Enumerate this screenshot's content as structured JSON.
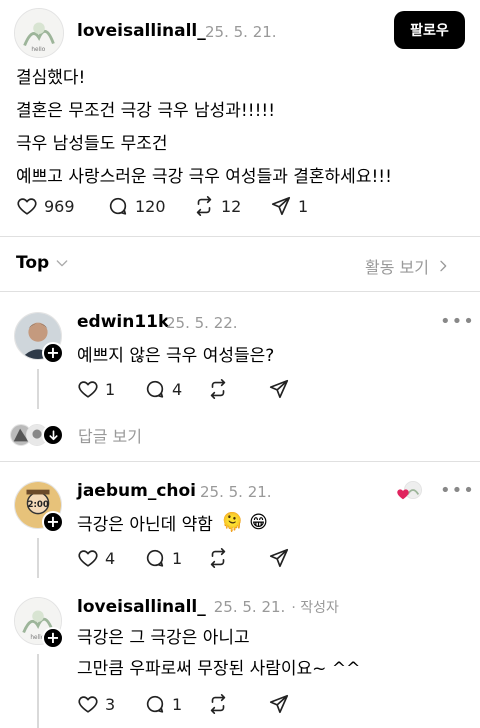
{
  "post": {
    "username": "loveisallinall_",
    "date": "25. 5. 21.",
    "follow_label": "팔로우",
    "lines": [
      "결심했다!",
      "결혼은 무조건 극강 극우 남성과!!!!!",
      "극우 남성들도 무조건",
      "예쁘고 사랑스러운 극강 극우 여성들과 결혼하세요!!!"
    ],
    "likes": "969",
    "comments": "120",
    "reposts": "12",
    "shares": "1"
  },
  "sort": {
    "label": "Top",
    "activity_label": "활동 보기"
  },
  "replies": [
    {
      "username": "edwin11k",
      "date": "25. 5. 22.",
      "text": "예쁘지 않은 극우 여성들은?",
      "likes": "1",
      "comments": "4",
      "view_replies": "답글 보기"
    },
    {
      "username": "jaebum_choi",
      "date": "25. 5. 21.",
      "text": "극강은 아닌데 약함",
      "emoji": "🫠 😁",
      "likes": "4",
      "comments": "1"
    },
    {
      "username": "loveisallinall_",
      "date": "25. 5. 21.",
      "author_tag": "· 작성자",
      "lines": [
        "극강은 그 극강은 아니고",
        "그만큼 우파로써 무장된 사람이요~ ^^"
      ],
      "likes": "3",
      "comments": "1"
    }
  ],
  "icons": {
    "heart": "heart-icon",
    "comment": "comment-icon",
    "repost": "repost-icon",
    "share": "share-icon",
    "chevron": "chevron-down-icon",
    "chevron_right": "chevron-right-icon",
    "more": "more-icon"
  },
  "colors": {
    "accent": "#000000",
    "secondary_text": "#999999",
    "like_heart": "#e0245e"
  }
}
